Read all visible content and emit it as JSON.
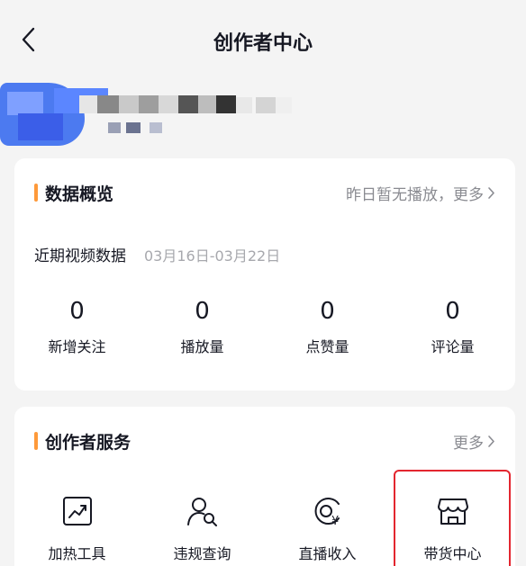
{
  "header": {
    "title": "创作者中心"
  },
  "overview": {
    "title": "数据概览",
    "more_text": "昨日暂无播放，更多",
    "period_label": "近期视频数据",
    "period_range": "03月16日-03月22日",
    "stats": [
      {
        "value": "0",
        "label": "新增关注"
      },
      {
        "value": "0",
        "label": "播放量"
      },
      {
        "value": "0",
        "label": "点赞量"
      },
      {
        "value": "0",
        "label": "评论量"
      }
    ]
  },
  "services": {
    "title": "创作者服务",
    "more_text": "更多",
    "items": [
      {
        "label": "加热工具",
        "icon": "trend-chart-icon"
      },
      {
        "label": "违规查询",
        "icon": "user-search-icon"
      },
      {
        "label": "直播收入",
        "icon": "yuan-coin-icon"
      },
      {
        "label": "带货中心",
        "icon": "storefront-icon"
      }
    ]
  },
  "colors": {
    "accent": "#fe9a3a",
    "highlight_box": "#e3262f",
    "background": "#f4f4f4"
  }
}
